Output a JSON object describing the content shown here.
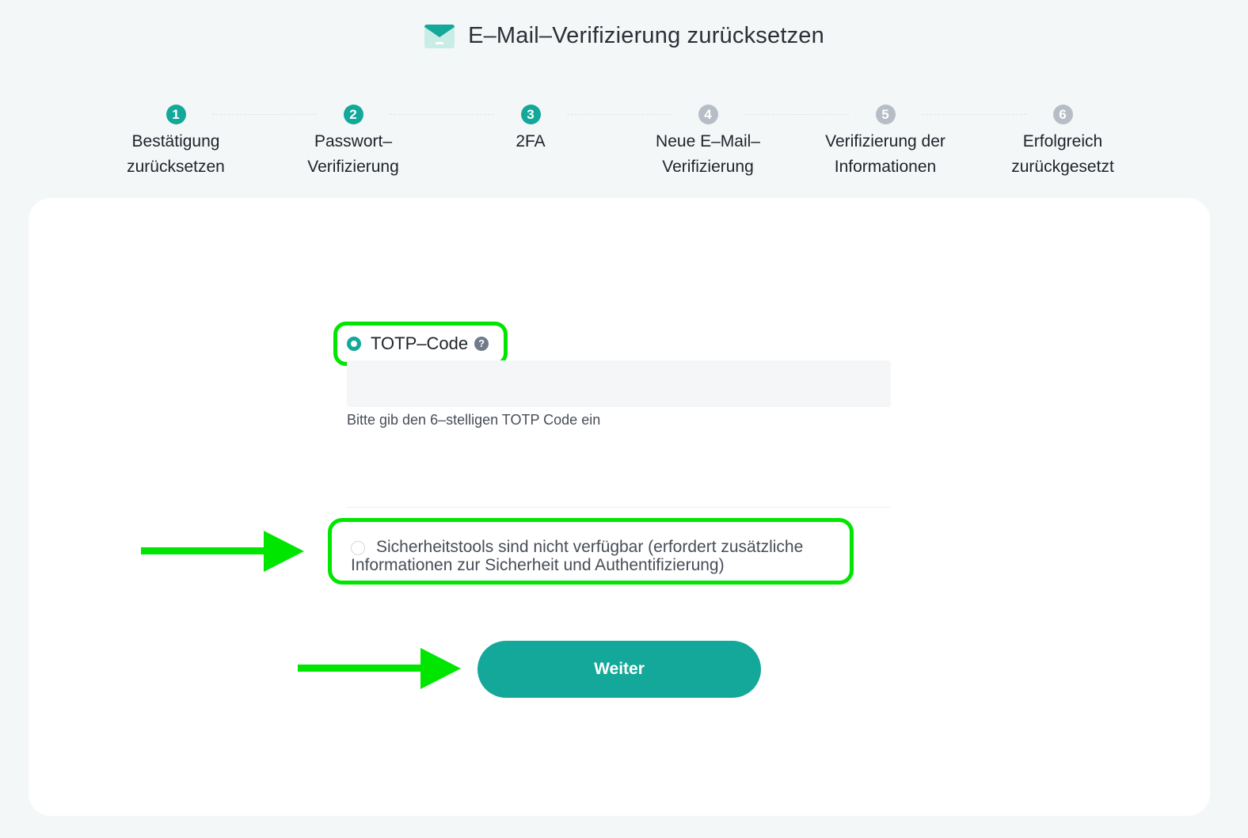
{
  "header": {
    "title": "E–Mail–Verifizierung zurücksetzen",
    "icon": "envelope-icon"
  },
  "stepper": {
    "steps": [
      {
        "number": "1",
        "label": "Bestätigung\nzurücksetzen",
        "state": "active"
      },
      {
        "number": "2",
        "label": "Passwort–\nVerifizierung",
        "state": "active"
      },
      {
        "number": "3",
        "label": "2FA",
        "state": "active"
      },
      {
        "number": "4",
        "label": "Neue E–Mail–\nVerifizierung",
        "state": "inactive"
      },
      {
        "number": "5",
        "label": "Verifizierung der\nInformationen",
        "state": "inactive"
      },
      {
        "number": "6",
        "label": "Erfolgreich\nzurückgesetzt",
        "state": "inactive"
      }
    ]
  },
  "form": {
    "totp_option": {
      "label": "TOTP–Code",
      "selected": true,
      "help_icon": "question-circle-icon"
    },
    "code_input": {
      "value": "",
      "placeholder": ""
    },
    "hint": "Bitte gib den 6–stelligen TOTP Code ein",
    "no_security_option": {
      "label": "Sicherheitstools sind nicht verfügbar (erfordert zusätzliche Informationen zur Sicherheit und Authentifizierung)",
      "selected": false
    },
    "continue_label": "Weiter"
  },
  "colors": {
    "accent": "#13a899",
    "inactive_step": "#b7bdc6",
    "highlight": "#00e600",
    "background": "#f4f7f8"
  }
}
